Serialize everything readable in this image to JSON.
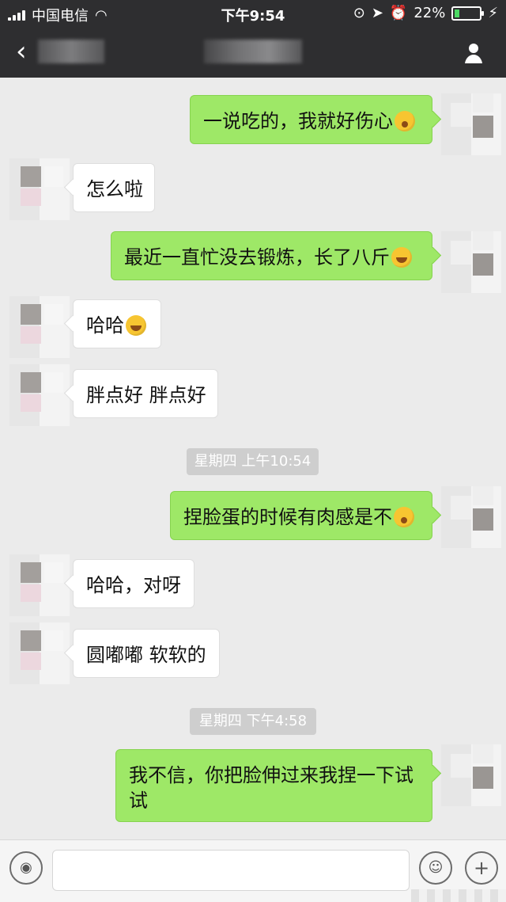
{
  "status_bar": {
    "carrier": "中国电信",
    "time": "下午9:54",
    "battery": "22%",
    "battery_level": 0.22
  },
  "icons": {
    "back": "back-icon",
    "profile": "profile-icon",
    "wifi": "wifi-icon",
    "location": "location-icon",
    "alarm": "alarm-icon",
    "lock": "orientation-lock-icon",
    "charging": "charging-icon",
    "voice": "voice-icon",
    "emoji": "emoji-icon",
    "plus": "plus-icon"
  },
  "messages": [
    {
      "side": "right",
      "text": "一说吃的，我就好伤心"
    },
    {
      "side": "left",
      "text": "怎么啦"
    },
    {
      "side": "right",
      "text": "最近一直忙没去锻炼，长了八斤"
    },
    {
      "side": "left",
      "text": "哈哈"
    },
    {
      "side": "left",
      "text": "胖点好 胖点好"
    },
    {
      "type": "time",
      "text": "星期四 上午10:54"
    },
    {
      "side": "right",
      "text": "捏脸蛋的时候有肉感是不"
    },
    {
      "side": "left",
      "text": "哈哈，对呀"
    },
    {
      "side": "left",
      "text": "圆嘟嘟 软软的"
    },
    {
      "type": "time",
      "text": "星期四 下午4:58"
    },
    {
      "side": "right",
      "text": "我不信，你把脸伸过来我捏一下试试"
    }
  ]
}
